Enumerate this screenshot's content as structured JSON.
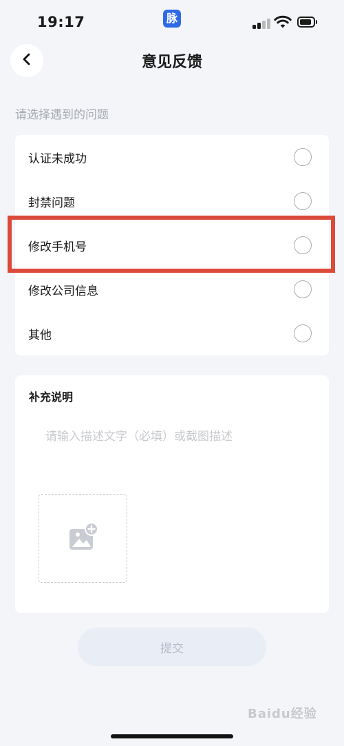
{
  "status_bar": {
    "time": "19:17",
    "app_badge": "脉"
  },
  "nav": {
    "title": "意见反馈",
    "back_icon": "chevron-left-icon"
  },
  "section_hint": "请选择遇到的问题",
  "options": [
    {
      "label": "认证未成功",
      "selected": false
    },
    {
      "label": "封禁问题",
      "selected": false
    },
    {
      "label": "修改手机号",
      "selected": false,
      "highlighted": true
    },
    {
      "label": "修改公司信息",
      "selected": false
    },
    {
      "label": "其他",
      "selected": false
    }
  ],
  "supplement": {
    "title": "补充说明",
    "placeholder": "请输入描述文字（必填）或截图描述",
    "value": "",
    "upload_icon": "add-image-icon"
  },
  "submit": {
    "label": "提交"
  },
  "watermark": "Baidu经验",
  "colors": {
    "background": "#f3f5f9",
    "card": "#ffffff",
    "highlight": "#dc4a3a",
    "submit_bg": "#e9edf5",
    "submit_text": "#b6bccb",
    "app_badge": "#2f6ae6"
  }
}
